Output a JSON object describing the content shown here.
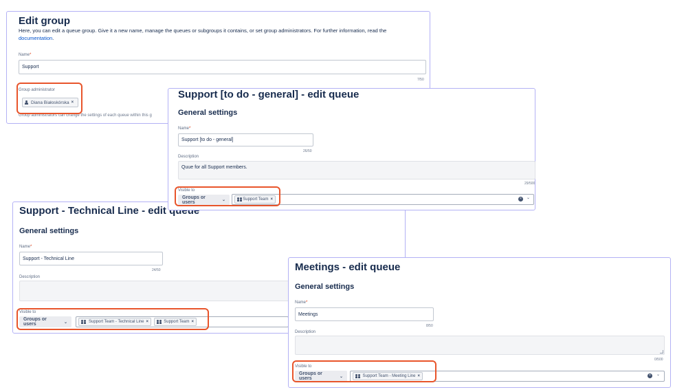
{
  "edit_group": {
    "title": "Edit group",
    "description": "Here, you can edit a queue group. Give it a new name, manage the queues or subgroups it contains, or set group administrators. For further information, read the",
    "link": "documentation",
    "link_suffix": ".",
    "name_label": "Name",
    "name_value": "Support",
    "name_count": "7/50",
    "admin_label": "Group administrator",
    "admin_chip": "Diana Białoskórska",
    "admin_help": "Group administrators can change the settings of each queue within this g"
  },
  "queue_general": {
    "title": "Support [to do - general] - edit queue",
    "section": "General settings",
    "name_label": "Name",
    "name_value": "Support [to do - general]",
    "name_count": "26/50",
    "desc_label": "Description",
    "desc_value": "Quue for all Support members.",
    "desc_count": "29/500",
    "visible_label": "Visible to",
    "groups_button": "Groups or users",
    "chips": [
      "Support Team"
    ]
  },
  "queue_technical": {
    "title": "Support - Technical Line - edit queue",
    "section": "General settings",
    "name_label": "Name",
    "name_value": "Support - Technical Line",
    "name_count": "24/50",
    "desc_label": "Description",
    "visible_label": "Visible to",
    "groups_button": "Groups or users",
    "chips": [
      "Support Team - Technical Line",
      "Support Team"
    ]
  },
  "queue_meetings": {
    "title": "Meetings - edit queue",
    "section": "General settings",
    "name_label": "Name",
    "name_value": "Meetings",
    "name_count": "8/50",
    "desc_label": "Description",
    "desc_count": "0/500",
    "visible_label": "Visible to",
    "groups_button": "Groups or users",
    "chips": [
      "Support Team - Meeting Line"
    ]
  },
  "required_mark": "*",
  "chip_remove": "×",
  "clear_symbol": "×",
  "chevron": "⌄",
  "icons": {
    "user": "user-icon",
    "team": "team-icon"
  },
  "colors": {
    "panel_border": "#b3b1f5",
    "highlight": "#e8542a",
    "link": "#0052cc"
  }
}
